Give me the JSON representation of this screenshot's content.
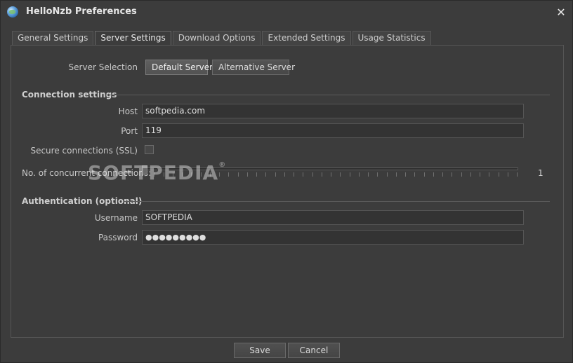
{
  "window": {
    "title": "HelloNzb Preferences",
    "close_glyph": "✕"
  },
  "tabs": [
    {
      "label": "General Settings",
      "active": false
    },
    {
      "label": "Server Settings",
      "active": true
    },
    {
      "label": "Download Options",
      "active": false
    },
    {
      "label": "Extended Settings",
      "active": false
    },
    {
      "label": "Usage Statistics",
      "active": false
    }
  ],
  "server_selection": {
    "label": "Server Selection",
    "default_label": "Default Server",
    "alternative_label": "Alternative Server",
    "selected": "Default Server"
  },
  "connection": {
    "section_title": "Connection settings",
    "host_label": "Host",
    "host_value": "softpedia.com",
    "port_label": "Port",
    "port_value": "119",
    "ssl_label": "Secure connections (SSL)",
    "ssl_checked": false,
    "concurrent_label": "No. of concurrent connections:",
    "concurrent_value": "1"
  },
  "authentication": {
    "section_title": "Authentication (optional)",
    "username_label": "Username",
    "username_value": "SOFTPEDIA",
    "password_label": "Password",
    "password_value": "●●●●●●●●●"
  },
  "watermark": {
    "text": "SOFTPEDIA",
    "mark": "®"
  },
  "footer": {
    "save_label": "Save",
    "cancel_label": "Cancel"
  }
}
